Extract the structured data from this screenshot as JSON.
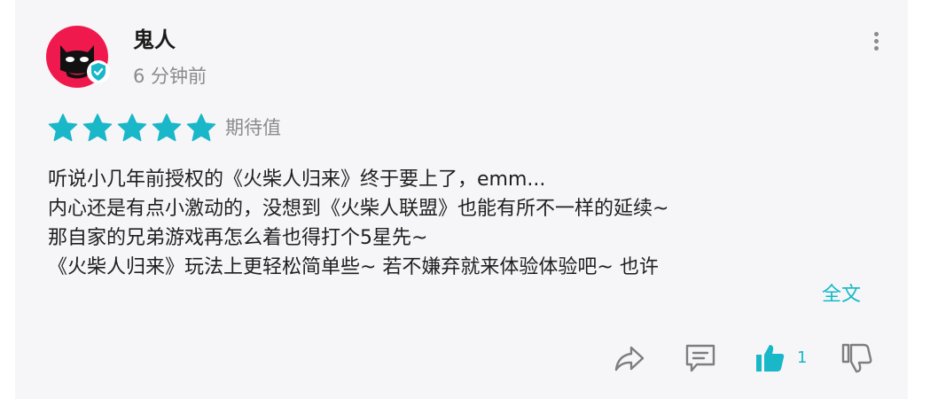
{
  "user": {
    "name": "鬼人",
    "time_ago": "6 分钟前",
    "avatar_color": "#f0194e",
    "verified_color": "#1ab7c9"
  },
  "rating": {
    "stars": 5,
    "max_stars": 5,
    "label": "期待值",
    "star_color": "#1ab7c9"
  },
  "review": {
    "lines": [
      "听说小几年前授权的《火柴人归来》终于要上了，emm...",
      "内心还是有点小激动的，没想到《火柴人联盟》也能有所不一样的延续~",
      "那自家的兄弟游戏再怎么着也得打个5星先~",
      "《火柴人归来》玩法上更轻松简单些~ 若不嫌弃就来体验体验吧~ 也许"
    ],
    "expand_label": "全文"
  },
  "actions": {
    "share_icon": "share-icon",
    "comment_icon": "comment-icon",
    "like_icon": "thumbs-up-icon",
    "like_count": "1",
    "dislike_icon": "thumbs-down-icon",
    "active_color": "#1ab7c9",
    "muted_color": "#7d7d82"
  },
  "more_icon": "vertical-ellipsis-icon"
}
